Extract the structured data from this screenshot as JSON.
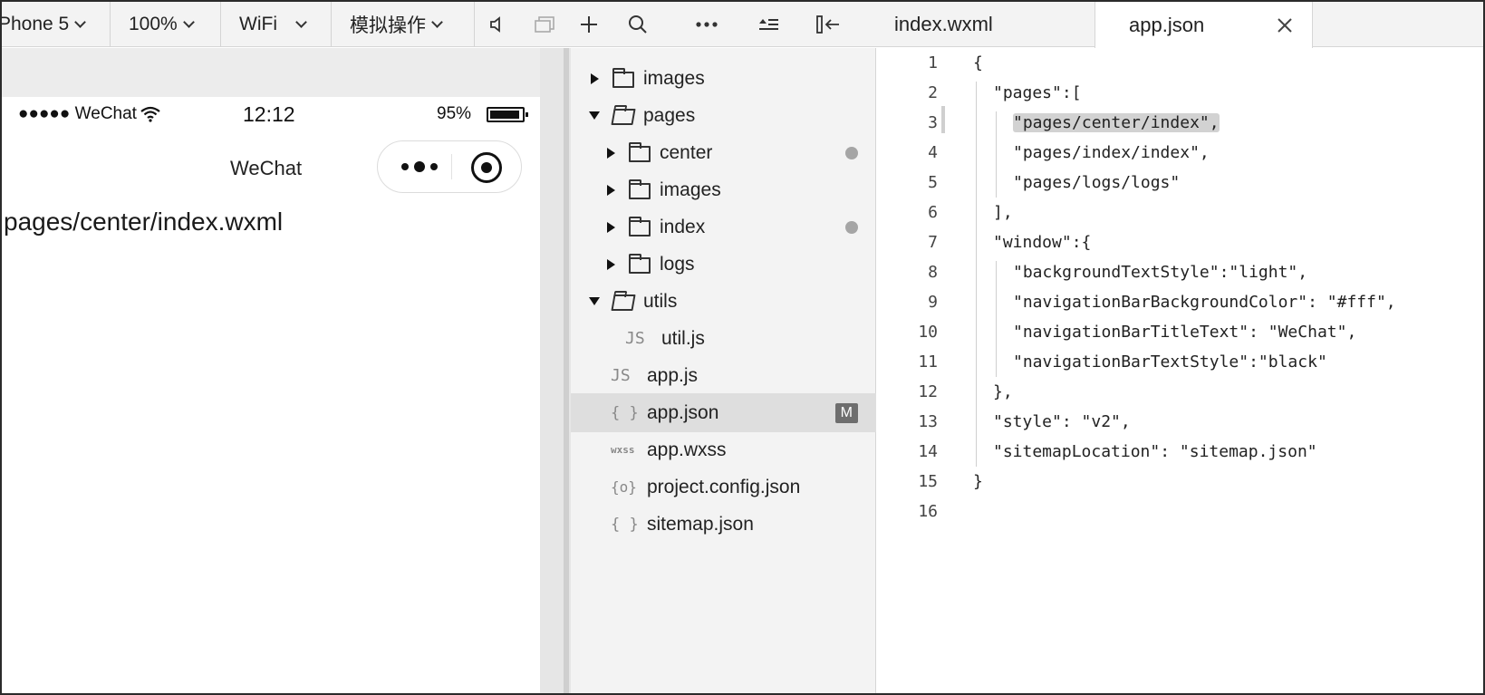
{
  "simulator": {
    "toolbar": {
      "device": "Phone 5",
      "zoom": "100%",
      "network": "WiFi",
      "simulate_action": "模拟操作"
    },
    "status_bar": {
      "signal": "●●●●● WeChat",
      "time": "12:12",
      "battery": "95%",
      "battery_level": 0.95
    },
    "nav_title": "WeChat",
    "page_text": "pages/center/index.wxml"
  },
  "file_tree": {
    "items": [
      {
        "type": "folder",
        "name": "images",
        "expanded": false,
        "level": 0
      },
      {
        "type": "folder",
        "name": "pages",
        "expanded": true,
        "level": 0
      },
      {
        "type": "folder",
        "name": "center",
        "expanded": false,
        "level": 1,
        "dot": true
      },
      {
        "type": "folder",
        "name": "images",
        "expanded": false,
        "level": 1
      },
      {
        "type": "folder",
        "name": "index",
        "expanded": false,
        "level": 1,
        "dot": true
      },
      {
        "type": "folder",
        "name": "logs",
        "expanded": false,
        "level": 1
      },
      {
        "type": "folder",
        "name": "utils",
        "expanded": true,
        "level": 0
      },
      {
        "type": "file",
        "icon": "JS",
        "name": "util.js",
        "level": 2
      },
      {
        "type": "file",
        "icon": "JS",
        "name": "app.js",
        "level": 1
      },
      {
        "type": "file",
        "icon": "{ }",
        "name": "app.json",
        "level": 1,
        "selected": true,
        "badge": "M"
      },
      {
        "type": "file",
        "icon": "wxss",
        "name": "app.wxss",
        "level": 1
      },
      {
        "type": "file",
        "icon": "{o}",
        "name": "project.config.json",
        "level": 1
      },
      {
        "type": "file",
        "icon": "{ }",
        "name": "sitemap.json",
        "level": 1
      }
    ]
  },
  "editor": {
    "tabs": [
      {
        "label": "index.wxml",
        "active": false
      },
      {
        "label": "app.json",
        "active": true
      }
    ],
    "lines": [
      {
        "n": "1",
        "indent": 0,
        "text": "{"
      },
      {
        "n": "2",
        "indent": 1,
        "text": "\"pages\":["
      },
      {
        "n": "3",
        "indent": 2,
        "text": "\"pages/center/index\",",
        "highlight": true
      },
      {
        "n": "4",
        "indent": 2,
        "text": "\"pages/index/index\","
      },
      {
        "n": "5",
        "indent": 2,
        "text": "\"pages/logs/logs\""
      },
      {
        "n": "6",
        "indent": 1,
        "text": "],"
      },
      {
        "n": "7",
        "indent": 1,
        "text": "\"window\":{"
      },
      {
        "n": "8",
        "indent": 2,
        "text": "\"backgroundTextStyle\":\"light\","
      },
      {
        "n": "9",
        "indent": 2,
        "text": "\"navigationBarBackgroundColor\": \"#fff\","
      },
      {
        "n": "10",
        "indent": 2,
        "text": "\"navigationBarTitleText\": \"WeChat\","
      },
      {
        "n": "11",
        "indent": 2,
        "text": "\"navigationBarTextStyle\":\"black\""
      },
      {
        "n": "12",
        "indent": 1,
        "text": "},"
      },
      {
        "n": "13",
        "indent": 1,
        "text": "\"style\": \"v2\","
      },
      {
        "n": "14",
        "indent": 1,
        "text": "\"sitemapLocation\": \"sitemap.json\""
      },
      {
        "n": "15",
        "indent": 0,
        "text": "}"
      },
      {
        "n": "16",
        "indent": 0,
        "text": ""
      }
    ]
  }
}
